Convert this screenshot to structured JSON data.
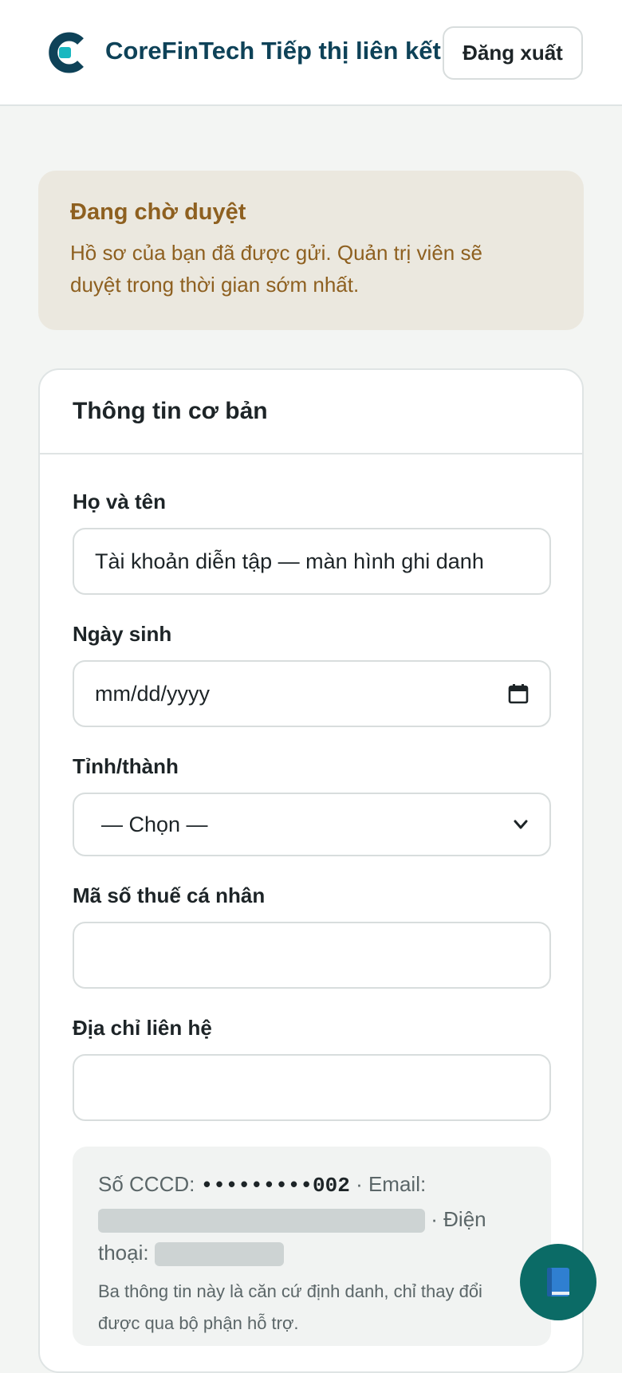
{
  "header": {
    "brand": "CoreFinTech Tiếp thị liên kết",
    "logout_label": "Đăng xuất",
    "logo_icon": "corefintech-logo-icon",
    "brand_color": "#0e4258",
    "accent_color": "#19b7c0"
  },
  "pending_notice": {
    "title": "Đang chờ duyệt",
    "message": "Hồ sơ của bạn đã được gửi. Quản trị viên sẽ duyệt trong thời gian sớm nhất.",
    "text_color": "#8e6020",
    "background": "#ebe8df"
  },
  "form": {
    "section_title": "Thông tin cơ bản",
    "full_name": {
      "label": "Họ và tên",
      "value": "Tài khoản diễn tập — màn hình ghi danh"
    },
    "birth_date": {
      "label": "Ngày sinh",
      "placeholder": "mm/dd/yyyy",
      "icon": "calendar-icon"
    },
    "province": {
      "label": "Tỉnh/thành",
      "selected": "— Chọn —",
      "icon": "chevron-down-icon"
    },
    "tax_id": {
      "label": "Mã số thuế cá nhân",
      "value": ""
    },
    "address": {
      "label": "Địa chỉ liên hệ",
      "value": ""
    },
    "identity": {
      "cccd_label": "Số CCCD:",
      "cccd_value": "•••••••••002",
      "separator": "·",
      "email_label": "Email:",
      "phone_label_1": "Điện",
      "phone_label_2": "thoại:",
      "note": "Ba thông tin này là căn cứ định danh, chỉ thay đổi được qua bộ phận hỗ trợ."
    }
  },
  "help_button": {
    "icon": "book-icon",
    "color": "#0b6b66"
  }
}
